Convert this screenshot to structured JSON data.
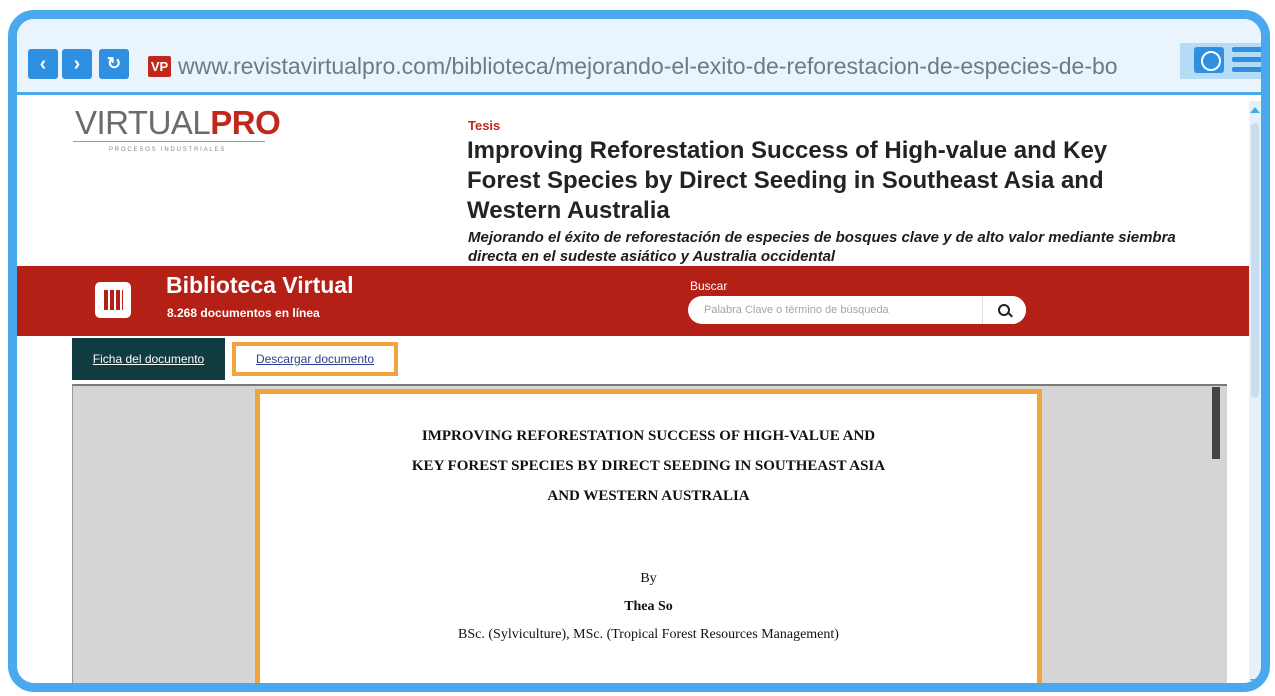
{
  "browser": {
    "back_label": "‹",
    "forward_label": "›",
    "reload_label": "↻",
    "favicon_text": "VP",
    "url": "www.revistavirtualpro.com/biblioteca/mejorando-el-exito-de-reforestacion-de-especies-de-bo"
  },
  "site": {
    "logo_prefix": "VIRTUAL",
    "logo_accent": "PRO",
    "logo_sub": "PROCESOS INDUSTRIALES"
  },
  "article": {
    "category": "Tesis",
    "title_en": "Improving Reforestation Success of High-value and Key Forest Species by Direct Seeding in Southeast Asia and Western Australia",
    "title_es": "Mejorando el éxito de reforestación de especies de bosques clave y de alto valor mediante siembra directa en el sudeste asiático y Australia occidental"
  },
  "library_bar": {
    "title": "Biblioteca Virtual",
    "count": "8.268 documentos en línea",
    "search_label": "Buscar",
    "search_placeholder": "Palabra Clave o término de búsqueda"
  },
  "tabs": {
    "ficha": "Ficha del documento",
    "descargar": "Descargar documento"
  },
  "document": {
    "title_line1": "IMPROVING REFORESTATION SUCCESS OF HIGH-VALUE AND",
    "title_line2": "KEY FOREST SPECIES BY DIRECT SEEDING IN SOUTHEAST ASIA",
    "title_line3": "AND WESTERN AUSTRALIA",
    "by": "By",
    "author": "Thea So",
    "credentials": "BSc. (Sylviculture), MSc. (Tropical Forest Resources Management)"
  },
  "colors": {
    "frame": "#4aa9ec",
    "brand_red": "#b41f16",
    "highlight": "#f2a43c",
    "tab_dark": "#0f3b41"
  }
}
